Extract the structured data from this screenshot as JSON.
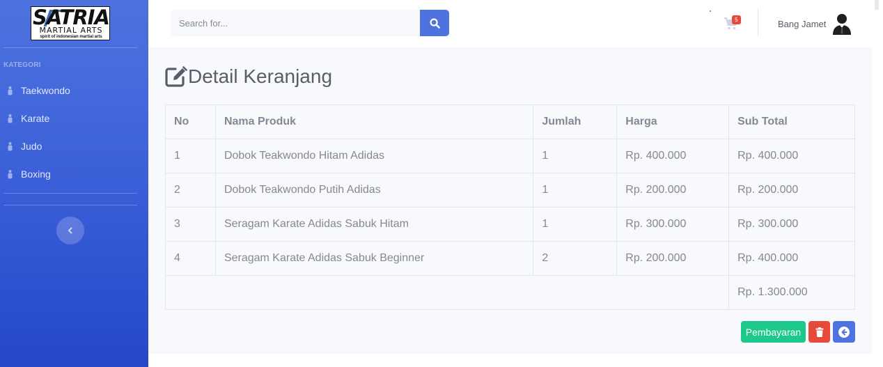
{
  "brand": {
    "logo_main": "SATRIA",
    "logo_sub": "MARTIAL ARTS",
    "logo_tagline": "spirit of indonesian martial arts"
  },
  "sidebar": {
    "heading": "KATEGORI",
    "items": [
      {
        "label": "Taekwondo",
        "icon": "user-icon"
      },
      {
        "label": "Karate",
        "icon": "user-icon"
      },
      {
        "label": "Judo",
        "icon": "user-icon"
      },
      {
        "label": "Boxing",
        "icon": "user-icon"
      }
    ]
  },
  "topbar": {
    "search_placeholder": "Search for...",
    "cart_count": "5",
    "user_name": "Bang Jamet"
  },
  "page": {
    "title": "Detail Keranjang"
  },
  "table": {
    "headers": [
      "No",
      "Nama Produk",
      "Jumlah",
      "Harga",
      "Sub Total"
    ],
    "rows": [
      [
        "1",
        "Dobok Teakwondo Hitam Adidas",
        "1",
        "Rp. 400.000",
        "Rp. 400.000"
      ],
      [
        "2",
        "Dobok Teakwondo Putih Adidas",
        "1",
        "Rp. 200.000",
        "Rp. 200.000"
      ],
      [
        "3",
        "Seragam Karate Adidas Sabuk Hitam",
        "1",
        "Rp. 300.000",
        "Rp. 300.000"
      ],
      [
        "4",
        "Seragam Karate Adidas Sabuk Beginner",
        "2",
        "Rp. 200.000",
        "Rp. 400.000"
      ]
    ],
    "total": "Rp. 1.300.000"
  },
  "actions": {
    "pay_label": "Pembayaran"
  },
  "colors": {
    "primary": "#4e73df",
    "success": "#1cc88a",
    "danger": "#e74a3b",
    "text": "#858796"
  }
}
